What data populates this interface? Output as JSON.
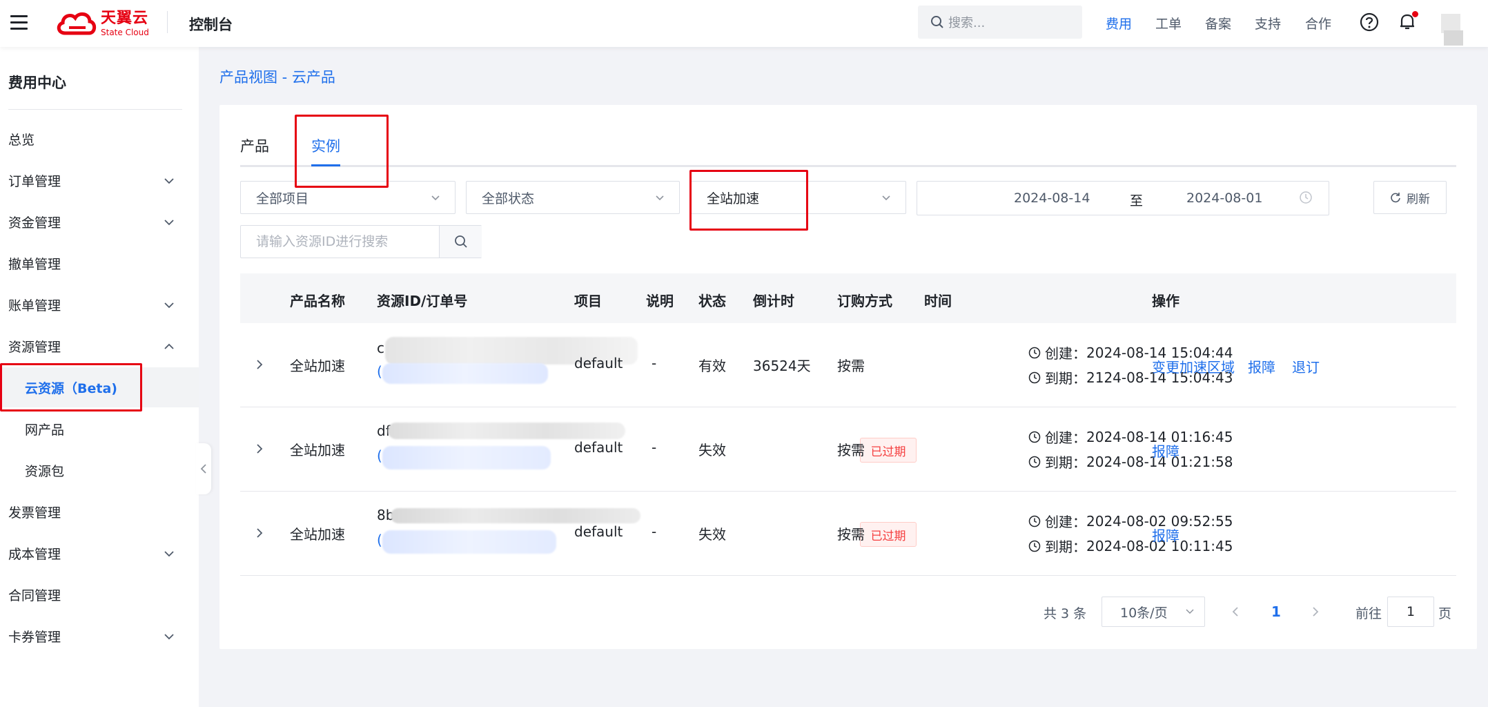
{
  "header": {
    "brand_cn": "天翼云",
    "brand_en": "State Cloud",
    "console_title": "控制台",
    "search_placeholder": "搜索...",
    "nav": [
      "费用",
      "工单",
      "备案",
      "支持",
      "合作"
    ],
    "active_nav": "费用",
    "colors": {
      "brand": "#e60012",
      "accent": "#1f6feb"
    }
  },
  "sidebar": {
    "title": "费用中心",
    "items": [
      {
        "label": "总览",
        "expandable": false
      },
      {
        "label": "订单管理",
        "expandable": true,
        "expanded": false
      },
      {
        "label": "资金管理",
        "expandable": true,
        "expanded": false
      },
      {
        "label": "撤单管理",
        "expandable": false
      },
      {
        "label": "账单管理",
        "expandable": true,
        "expanded": false
      },
      {
        "label": "资源管理",
        "expandable": true,
        "expanded": true
      },
      {
        "label": "云资源（Beta)",
        "sub": true,
        "active": true
      },
      {
        "label": "网产品",
        "sub": true
      },
      {
        "label": "资源包",
        "sub": true
      },
      {
        "label": "发票管理",
        "expandable": false
      },
      {
        "label": "成本管理",
        "expandable": true,
        "expanded": false
      },
      {
        "label": "合同管理",
        "expandable": false
      },
      {
        "label": "卡券管理",
        "expandable": true,
        "expanded": false
      }
    ]
  },
  "main": {
    "breadcrumb": "产品视图 - 云产品",
    "tabs": [
      "产品",
      "实例"
    ],
    "active_tab": "实例",
    "filters": {
      "project": "全部项目",
      "status": "全部状态",
      "product": "全站加速",
      "date_start": "2024-08-14",
      "date_sep": "至",
      "date_end": "2024-08-01",
      "refresh_label": "刷新",
      "resource_search_placeholder": "请输入资源ID进行搜索"
    },
    "table": {
      "columns": [
        "产品名称",
        "资源ID/订单号",
        "项目",
        "说明",
        "状态",
        "倒计时",
        "订购方式",
        "时间",
        "操作"
      ],
      "rows": [
        {
          "product": "全站加速",
          "resource_id_prefix": "c",
          "order_prefix": "(",
          "project": "default",
          "note": "-",
          "status": "有效",
          "countdown": "36524天",
          "expired_tag": "",
          "billing": "按需",
          "created_label": "创建：",
          "created": "2024-08-14 15:04:44",
          "expires_label": "到期：",
          "expires": "2124-08-14 15:04:43",
          "actions": [
            "变更加速区域",
            "报障",
            "退订"
          ]
        },
        {
          "product": "全站加速",
          "resource_id_prefix": "df",
          "order_prefix": "(",
          "project": "default",
          "note": "-",
          "status": "失效",
          "countdown": "",
          "expired_tag": "已过期",
          "billing": "按需",
          "created_label": "创建：",
          "created": "2024-08-14 01:16:45",
          "expires_label": "到期：",
          "expires": "2024-08-14 01:21:58",
          "actions": [
            "报障"
          ]
        },
        {
          "product": "全站加速",
          "resource_id_prefix": "8b",
          "order_prefix": "(",
          "project": "default",
          "note": "-",
          "status": "失效",
          "countdown": "",
          "expired_tag": "已过期",
          "billing": "按需",
          "created_label": "创建：",
          "created": "2024-08-02 09:52:55",
          "expires_label": "到期：",
          "expires": "2024-08-02 10:11:45",
          "actions": [
            "报障"
          ]
        }
      ]
    },
    "pagination": {
      "total": "共 3 条",
      "page_size": "10条/页",
      "current_page": "1",
      "goto_label": "前往",
      "goto_value": "1",
      "page_unit": "页"
    }
  }
}
